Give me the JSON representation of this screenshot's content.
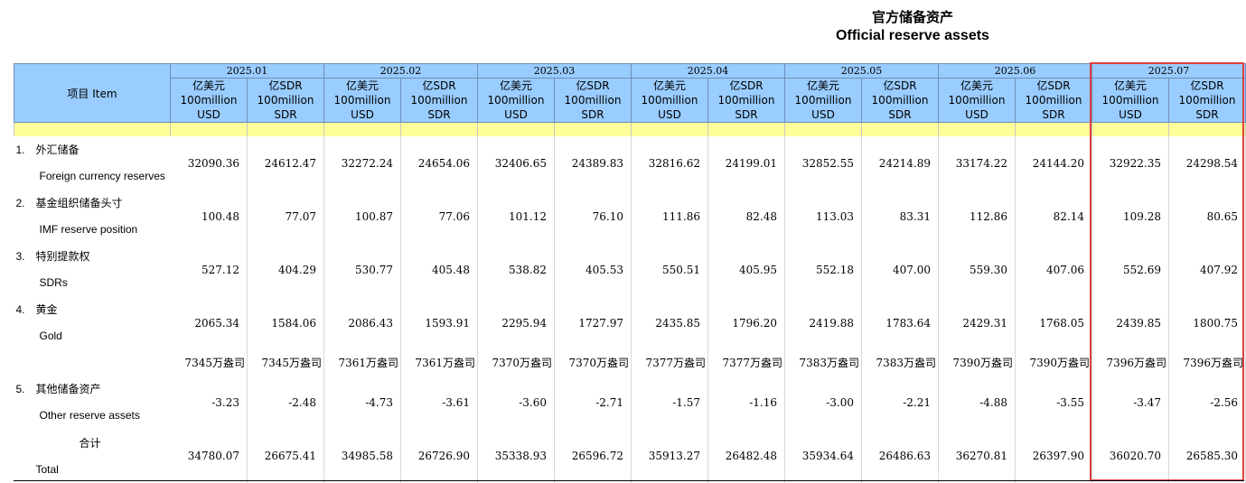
{
  "title": {
    "cn": "官方储备资产",
    "en": "Official reserve assets"
  },
  "header": {
    "item_label": "项目 Item",
    "months": [
      "2025.01",
      "2025.02",
      "2025.03",
      "2025.04",
      "2025.05",
      "2025.06",
      "2025.07"
    ],
    "unit_usd": [
      "亿美元",
      "100million",
      "USD"
    ],
    "unit_sdr": [
      "亿SDR",
      "100million",
      "SDR"
    ]
  },
  "rows": [
    {
      "num": "1.",
      "cn": "外汇储备",
      "en": "Foreign currency reserves",
      "values": [
        "32090.36",
        "24612.47",
        "32272.24",
        "24654.06",
        "32406.65",
        "24389.83",
        "32816.62",
        "24199.01",
        "32852.55",
        "24214.89",
        "33174.22",
        "24144.20",
        "32922.35",
        "24298.54"
      ]
    },
    {
      "num": "2.",
      "cn": "基金组织储备头寸",
      "en": "IMF reserve position",
      "values": [
        "100.48",
        "77.07",
        "100.87",
        "77.06",
        "101.12",
        "76.10",
        "111.86",
        "82.48",
        "113.03",
        "83.31",
        "112.86",
        "82.14",
        "109.28",
        "80.65"
      ]
    },
    {
      "num": "3.",
      "cn": "特别提款权",
      "en": "SDRs",
      "values": [
        "527.12",
        "404.29",
        "530.77",
        "405.48",
        "538.82",
        "405.53",
        "550.51",
        "405.95",
        "552.18",
        "407.00",
        "559.30",
        "407.06",
        "552.69",
        "407.92"
      ]
    },
    {
      "num": "4.",
      "cn": "黄金",
      "en": "Gold",
      "values": [
        "2065.34",
        "1584.06",
        "2086.43",
        "1593.91",
        "2295.94",
        "1727.97",
        "2435.85",
        "1796.20",
        "2419.88",
        "1783.64",
        "2429.31",
        "1768.05",
        "2439.85",
        "1800.75"
      ]
    },
    {
      "num": "",
      "cn": "",
      "en": "",
      "values": [
        "7345万盎司",
        "7345万盎司",
        "7361万盎司",
        "7361万盎司",
        "7370万盎司",
        "7370万盎司",
        "7377万盎司",
        "7377万盎司",
        "7383万盎司",
        "7383万盎司",
        "7390万盎司",
        "7390万盎司",
        "7396万盎司",
        "7396万盎司"
      ]
    },
    {
      "num": "5.",
      "cn": "其他储备资产",
      "en": "Other reserve assets",
      "values": [
        "-3.23",
        "-2.48",
        "-4.73",
        "-3.61",
        "-3.60",
        "-2.71",
        "-1.57",
        "-1.16",
        "-3.00",
        "-2.21",
        "-4.88",
        "-3.55",
        "-3.47",
        "-2.56"
      ]
    },
    {
      "num": "",
      "cn": "合计",
      "en": "Total",
      "values": [
        "34780.07",
        "26675.41",
        "34985.58",
        "26726.90",
        "35338.93",
        "26596.72",
        "35913.27",
        "26482.48",
        "35934.64",
        "26486.63",
        "36270.81",
        "26397.90",
        "36020.70",
        "26585.30"
      ]
    }
  ]
}
